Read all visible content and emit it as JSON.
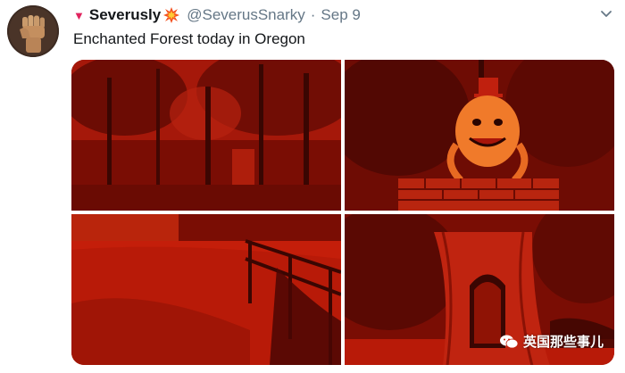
{
  "tweet": {
    "display_name": "Severusly",
    "handle": "@SeverusSnarky",
    "separator": "·",
    "date": "Sep 9",
    "text": "Enchanted Forest today in Oregon"
  },
  "icons": {
    "avatar": "raised-fist-avatar",
    "name_badge": "red-triangle-icon",
    "name_emoji": "collision-burst-icon",
    "caret": "chevron-down-icon",
    "watermark": "wechat-icon"
  },
  "media": {
    "photo_count": 4,
    "photo_descriptions_visible": false
  },
  "watermark": {
    "text": "英国那些事儿"
  },
  "colors": {
    "text_primary": "#14171a",
    "text_secondary": "#657786",
    "photo_tint": "#c0200e",
    "badge_red": "#e0245e"
  }
}
